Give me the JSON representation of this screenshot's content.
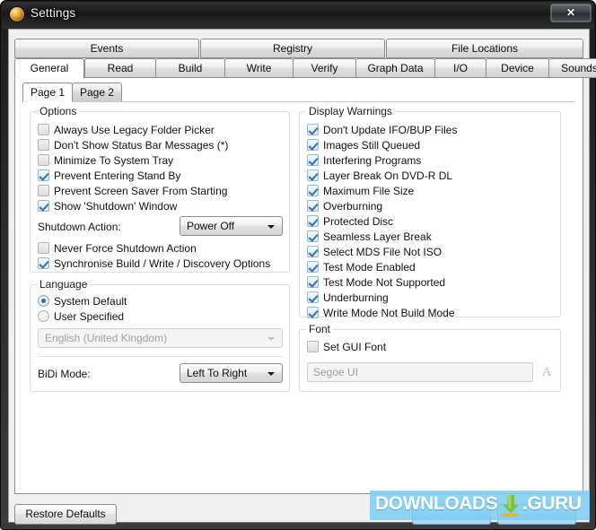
{
  "window": {
    "title": "Settings",
    "icon": "disc-icon",
    "close_label": "✕"
  },
  "tabs": {
    "row1": [
      {
        "label": "Events",
        "active": false
      },
      {
        "label": "Registry",
        "active": false
      },
      {
        "label": "File Locations",
        "active": false
      }
    ],
    "row2": [
      {
        "label": "General",
        "active": true
      },
      {
        "label": "Read",
        "active": false
      },
      {
        "label": "Build",
        "active": false
      },
      {
        "label": "Write",
        "active": false
      },
      {
        "label": "Verify",
        "active": false
      },
      {
        "label": "Graph Data",
        "active": false
      },
      {
        "label": "I/O",
        "active": false
      },
      {
        "label": "Device",
        "active": false
      },
      {
        "label": "Sounds",
        "active": false
      }
    ]
  },
  "inner_tabs": [
    {
      "label": "Page 1",
      "active": true
    },
    {
      "label": "Page 2",
      "active": false
    }
  ],
  "options_group": {
    "title": "Options",
    "checkboxes": [
      {
        "label": "Always Use Legacy Folder Picker",
        "checked": false
      },
      {
        "label": "Don't Show Status Bar Messages (*)",
        "checked": false
      },
      {
        "label": "Minimize To System Tray",
        "checked": false
      },
      {
        "label": "Prevent Entering Stand By",
        "checked": true
      },
      {
        "label": "Prevent Screen Saver From Starting",
        "checked": false
      },
      {
        "label": "Show 'Shutdown' Window",
        "checked": true
      }
    ],
    "shutdown_action_label": "Shutdown Action:",
    "shutdown_action_value": "Power Off",
    "shutdown_checkboxes": [
      {
        "label": "Never Force Shutdown Action",
        "checked": false
      },
      {
        "label": "Synchronise Build / Write / Discovery Options",
        "checked": true
      }
    ]
  },
  "language_group": {
    "title": "Language",
    "radios": [
      {
        "label": "System Default",
        "selected": true
      },
      {
        "label": "User Specified",
        "selected": false
      }
    ],
    "language_value": "English (United Kingdom)",
    "language_disabled": true,
    "bidi_label": "BiDi Mode:",
    "bidi_value": "Left To Right"
  },
  "warnings_group": {
    "title": "Display Warnings",
    "checkboxes": [
      {
        "label": "Don't Update IFO/BUP Files",
        "checked": true
      },
      {
        "label": "Images Still Queued",
        "checked": true
      },
      {
        "label": "Interfering Programs",
        "checked": true
      },
      {
        "label": "Layer Break On DVD-R DL",
        "checked": true
      },
      {
        "label": "Maximum File Size",
        "checked": true
      },
      {
        "label": "Overburning",
        "checked": true
      },
      {
        "label": "Protected Disc",
        "checked": true
      },
      {
        "label": "Seamless Layer Break",
        "checked": true
      },
      {
        "label": "Select MDS File Not ISO",
        "checked": true
      },
      {
        "label": "Test Mode Enabled",
        "checked": true
      },
      {
        "label": "Test Mode Not Supported",
        "checked": true
      },
      {
        "label": "Underburning",
        "checked": true
      },
      {
        "label": "Write Mode Not Build Mode",
        "checked": true
      }
    ]
  },
  "font_group": {
    "title": "Font",
    "set_gui_font_label": "Set GUI Font",
    "set_gui_font_checked": false,
    "font_value": "Segoe UI",
    "font_disabled": true,
    "font_picker_icon": "A"
  },
  "footer": {
    "restore_defaults_label": "Restore Defaults"
  },
  "watermark": {
    "text_1": "DOWNLOADS",
    "text_2": ".GURU",
    "bg_color": "#78ccf0",
    "text_color": "#ffffff",
    "arrow_icon": "download-arrow-icon"
  }
}
